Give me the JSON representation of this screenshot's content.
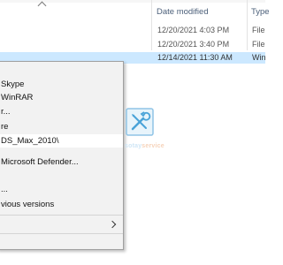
{
  "columns": {
    "date_modified": "Date modified",
    "type": "Type"
  },
  "files": [
    {
      "date": "12/20/2021 4:03 PM",
      "type": "File",
      "selected": false
    },
    {
      "date": "12/20/2021 3:40 PM",
      "type": "File",
      "selected": false
    },
    {
      "date": "12/14/2021 11:30 AM",
      "type": "Win",
      "selected": true
    }
  ],
  "context_menu": {
    "items": [
      {
        "label": "Skype"
      },
      {
        "label": "WinRAR"
      },
      {
        "label": "r..."
      },
      {
        "label": "re"
      },
      {
        "label": "DS_Max_2010\\"
      },
      {
        "label": "Microsoft Defender..."
      },
      {
        "label": "..."
      },
      {
        "label": "vious versions"
      },
      {
        "label": ""
      },
      {
        "label": ""
      }
    ]
  },
  "watermark": {
    "text_part1": "sotay",
    "text_part2": "service"
  },
  "colors": {
    "selection": "#cce8ff",
    "menu_background": "#f2f2f2",
    "header_text": "#4c607a"
  }
}
